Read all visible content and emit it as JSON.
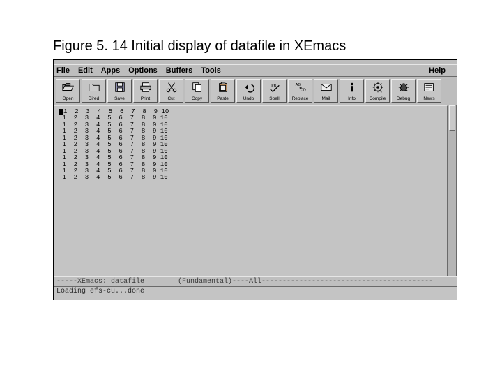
{
  "caption": "Figure 5. 14  Initial display of datafile in XEmacs",
  "menus": {
    "left": [
      "File",
      "Edit",
      "Apps",
      "Options",
      "Buffers",
      "Tools"
    ],
    "right": "Help"
  },
  "toolbar": [
    {
      "name": "open",
      "label": "Open"
    },
    {
      "name": "dired",
      "label": "Dired"
    },
    {
      "name": "save",
      "label": "Save"
    },
    {
      "name": "print",
      "label": "Print"
    },
    {
      "name": "cut",
      "label": "Cut"
    },
    {
      "name": "copy",
      "label": "Copy"
    },
    {
      "name": "paste",
      "label": "Paste"
    },
    {
      "name": "undo",
      "label": "Undo"
    },
    {
      "name": "spell",
      "label": "Spell"
    },
    {
      "name": "replace",
      "label": "Replace"
    },
    {
      "name": "mail",
      "label": "Mail"
    },
    {
      "name": "info",
      "label": "Info"
    },
    {
      "name": "compile",
      "label": "Compile"
    },
    {
      "name": "debug",
      "label": "Debug"
    },
    {
      "name": "news",
      "label": "News"
    }
  ],
  "data_rows": [
    [
      1,
      2,
      3,
      4,
      5,
      6,
      7,
      8,
      9,
      10
    ],
    [
      1,
      2,
      3,
      4,
      5,
      6,
      7,
      8,
      9,
      10
    ],
    [
      1,
      2,
      3,
      4,
      5,
      6,
      7,
      8,
      9,
      10
    ],
    [
      1,
      2,
      3,
      4,
      5,
      6,
      7,
      8,
      9,
      10
    ],
    [
      1,
      2,
      3,
      4,
      5,
      6,
      7,
      8,
      9,
      10
    ],
    [
      1,
      2,
      3,
      4,
      5,
      6,
      7,
      8,
      9,
      10
    ],
    [
      1,
      2,
      3,
      4,
      5,
      6,
      7,
      8,
      9,
      10
    ],
    [
      1,
      2,
      3,
      4,
      5,
      6,
      7,
      8,
      9,
      10
    ],
    [
      1,
      2,
      3,
      4,
      5,
      6,
      7,
      8,
      9,
      10
    ],
    [
      1,
      2,
      3,
      4,
      5,
      6,
      7,
      8,
      9,
      10
    ],
    [
      1,
      2,
      3,
      4,
      5,
      6,
      7,
      8,
      9,
      10
    ]
  ],
  "mode_line": {
    "prefix": "-----XEmacs: ",
    "buffer": "datafile",
    "mode": "(Fundamental)",
    "position": "All",
    "sep": "----",
    "tail": "-----------------------------------------"
  },
  "minibuffer": "Loading efs-cu...done"
}
